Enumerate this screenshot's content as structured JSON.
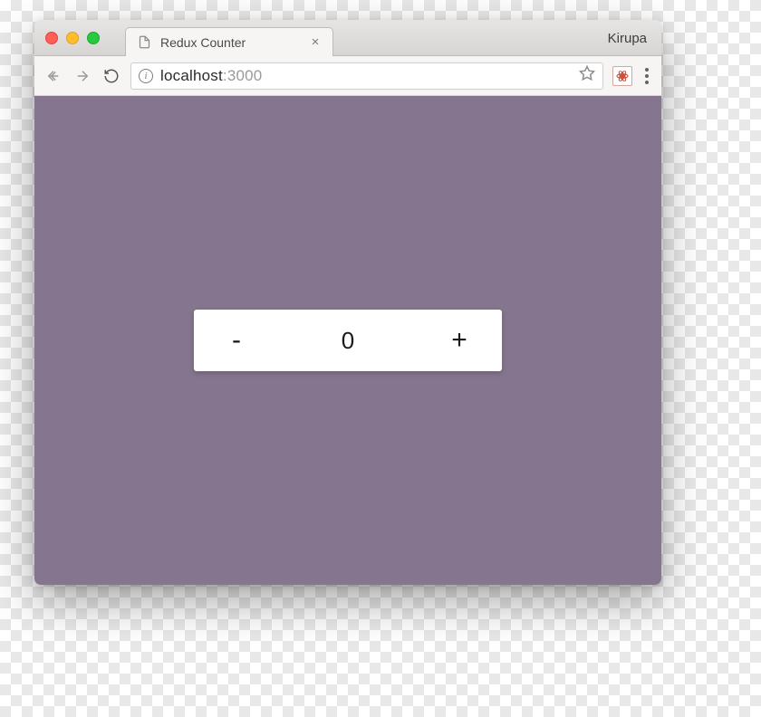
{
  "browser": {
    "profile_name": "Kirupa",
    "tab": {
      "title": "Redux Counter",
      "close_glyph": "×"
    },
    "url": {
      "host": "localhost",
      "port": ":3000",
      "info_glyph": "i"
    }
  },
  "counter": {
    "decrement_label": "-",
    "value": "0",
    "increment_label": "+"
  }
}
